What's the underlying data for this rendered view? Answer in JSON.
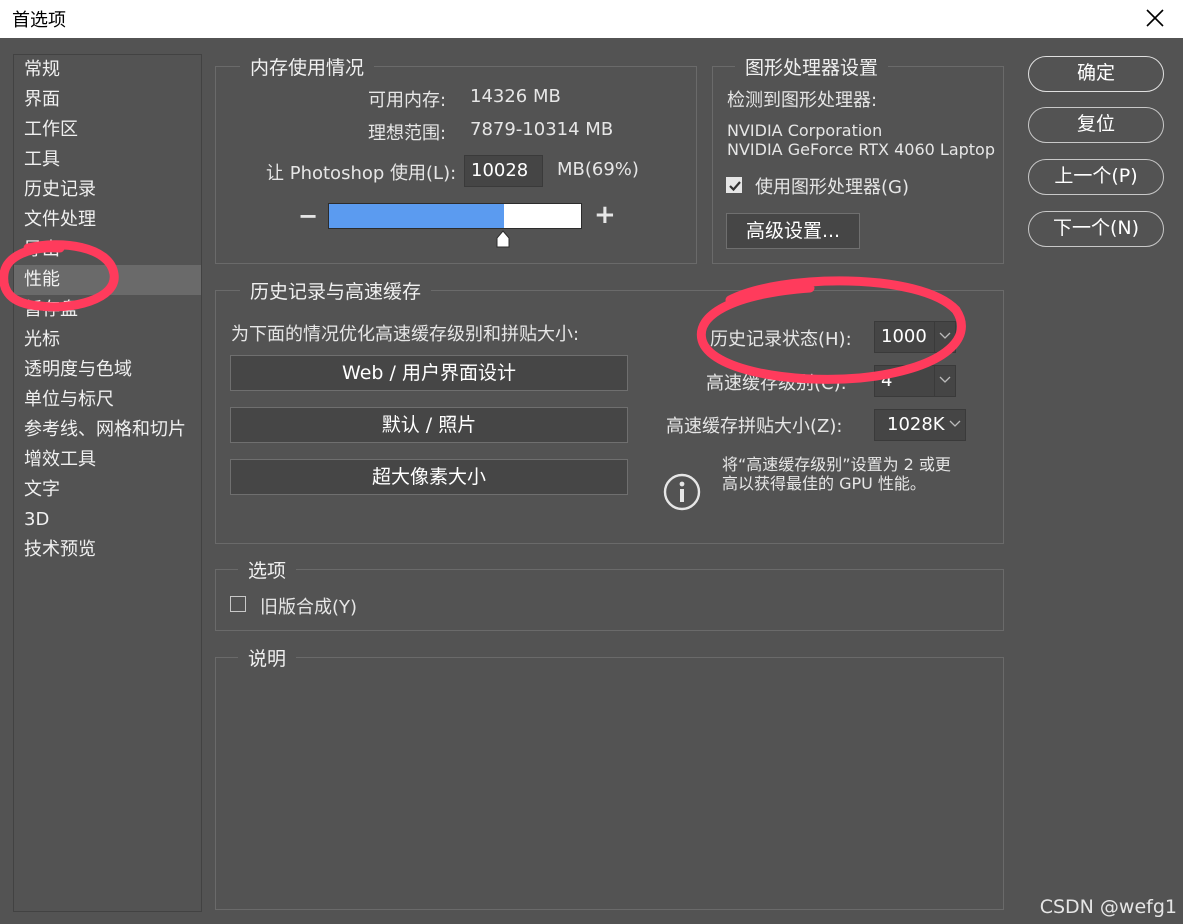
{
  "window": {
    "title": "首选项"
  },
  "sidebar": {
    "items": [
      {
        "label": "常规"
      },
      {
        "label": "界面"
      },
      {
        "label": "工作区"
      },
      {
        "label": "工具"
      },
      {
        "label": "历史记录"
      },
      {
        "label": "文件处理"
      },
      {
        "label": "导出"
      },
      {
        "label": "性能"
      },
      {
        "label": "暂存盘"
      },
      {
        "label": "光标"
      },
      {
        "label": "透明度与色域"
      },
      {
        "label": "单位与标尺"
      },
      {
        "label": "参考线、网格和切片"
      },
      {
        "label": "增效工具"
      },
      {
        "label": "文字"
      },
      {
        "label": "3D"
      },
      {
        "label": "技术预览"
      }
    ],
    "selected": "性能"
  },
  "memory": {
    "legend": "内存使用情况",
    "available_label": "可用内存:",
    "available_value": "14326 MB",
    "ideal_label": "理想范围:",
    "ideal_value": "7879-10314 MB",
    "let_label": "让 Photoshop 使用(L):",
    "let_value": "10028",
    "unit_pct": "MB(69%)",
    "slider_fraction": 0.69,
    "minus": "−",
    "plus": "+"
  },
  "gpu": {
    "legend": "图形处理器设置",
    "detected_label": "检测到图形处理器:",
    "vendor": "NVIDIA Corporation",
    "model": "NVIDIA GeForce RTX 4060 Laptop",
    "use_gpu_label": "使用图形处理器(G)",
    "use_gpu_checked": true,
    "advanced_button": "高级设置..."
  },
  "history_cache": {
    "legend": "历史记录与高速缓存",
    "optimize_label": "为下面的情况优化高速缓存级别和拼贴大小:",
    "buttons": [
      "Web / 用户界面设计",
      "默认 / 照片",
      "超大像素大小"
    ],
    "history_states_label": "历史记录状态(H):",
    "history_states_value": "1000",
    "cache_levels_label": "高速缓存级别(C):",
    "cache_levels_value": "4",
    "tile_size_label": "高速缓存拼贴大小(Z):",
    "tile_size_value": "1028K",
    "info_line1": "将“高速缓存级别”设置为 2 或更",
    "info_line2": "高以获得最佳的 GPU 性能。"
  },
  "options": {
    "legend": "选项",
    "legacy_compositing_label": "旧版合成(Y)",
    "legacy_compositing_checked": false
  },
  "description": {
    "legend": "说明"
  },
  "actions": {
    "ok": "确定",
    "reset": "复位",
    "prev": "上一个(P)",
    "next": "下一个(N)"
  },
  "watermark": "CSDN @wefg1",
  "colors": {
    "background": "#535353",
    "slider_fill": "#5b9bf0",
    "annotation_red": "#ff3b5c"
  }
}
